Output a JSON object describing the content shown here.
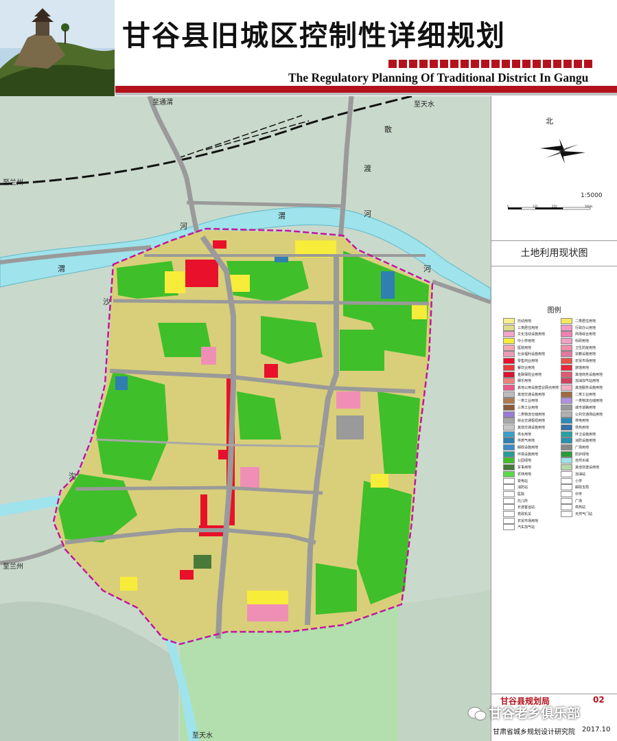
{
  "header": {
    "title_cn": "甘谷县旧城区控制性详细规划",
    "title_en": "The Regulatory Planning Of Traditional District In Gangu"
  },
  "map": {
    "direction_labels": {
      "to_tongwei": "至通渭",
      "to_tianshui_top": "至天水",
      "to_lanzhou_top": "至兰州",
      "to_lanzhou_bottom": "至兰州",
      "to_tianshui_bottom": "至天水"
    },
    "river_labels": {
      "wei_1": "渭",
      "he_1": "河",
      "wei_2": "渭",
      "he_2": "河",
      "san": "散",
      "du": "渡",
      "he_3": "河",
      "sha": "沙",
      "gou": "沟"
    },
    "colors": {
      "residential": "#d9cf7a",
      "green": "#3fbf2a",
      "commercial": "#e8102a",
      "school": "#f7ec3a",
      "pink": "#f08fb5",
      "road": "#9a9a9a",
      "river": "#9fe3ec",
      "terrain": "#c9d9cc",
      "boundary": "#c0169a"
    }
  },
  "panel": {
    "north_label": "北",
    "scale_ratio": "1:5000",
    "scale_ticks": [
      "0",
      "125",
      "250",
      "500m"
    ],
    "sheet_title": "土地利用现状图",
    "legend_title": "图例",
    "legend_left": [
      {
        "label": "托幼用地",
        "color": "#f7f08a"
      },
      {
        "label": "三类居住用地",
        "color": "#e2d98a"
      },
      {
        "label": "文化活动设施用地",
        "color": "#f2a6c6"
      },
      {
        "label": "中小学用地",
        "color": "#f7ec3a"
      },
      {
        "label": "医院用地",
        "color": "#f4a7b0"
      },
      {
        "label": "社会福利设施用地",
        "color": "#e99bb6"
      },
      {
        "label": "零售商业用地",
        "color": "#e8102a"
      },
      {
        "label": "餐饮业用地",
        "color": "#e83a3a"
      },
      {
        "label": "金融保险业用地",
        "color": "#d41430"
      },
      {
        "label": "娱乐用地",
        "color": "#f57f7f"
      },
      {
        "label": "其他公用设施营业网点用地",
        "color": "#e85a8a"
      },
      {
        "label": "其他交通设施用地",
        "color": "#bcbcbc"
      },
      {
        "label": "一类工业用地",
        "color": "#b07a50"
      },
      {
        "label": "三类工业用地",
        "color": "#8a5a3a"
      },
      {
        "label": "二类物流仓储用地",
        "color": "#9a7ad6"
      },
      {
        "label": "综合交通枢纽用地",
        "color": "#a8a8a8"
      },
      {
        "label": "其他交通设施用地",
        "color": "#c8c8c8"
      },
      {
        "label": "供水用地",
        "color": "#3aa0c8"
      },
      {
        "label": "供燃气用地",
        "color": "#2f7fb0"
      },
      {
        "label": "邮政设施用地",
        "color": "#3a8ac8"
      },
      {
        "label": "环境设施用地",
        "color": "#2a9a9a"
      },
      {
        "label": "公园绿地",
        "color": "#3fbf2a"
      },
      {
        "label": "军事用地",
        "color": "#4a7a3a"
      },
      {
        "label": "农林用地",
        "color": "#5ad84a"
      },
      {
        "label": "变电站",
        "color": "#ffffff"
      },
      {
        "label": "消防站",
        "color": "#ffffff"
      },
      {
        "label": "医院",
        "color": "#ffffff"
      },
      {
        "label": "托儿所",
        "color": "#ffffff"
      },
      {
        "label": "长途客运站",
        "color": "#ffffff"
      },
      {
        "label": "党政机关",
        "color": "#ffffff"
      },
      {
        "label": "农贸市场用地",
        "color": "#ffffff"
      },
      {
        "label": "汽车加气站",
        "color": "#ffffff"
      }
    ],
    "legend_right": [
      {
        "label": "二类居住用地",
        "color": "#f2e860"
      },
      {
        "label": "行政办公用地",
        "color": "#f49ac8"
      },
      {
        "label": "商场综合用地",
        "color": "#f280b0"
      },
      {
        "label": "科研用地",
        "color": "#f0a0c0"
      },
      {
        "label": "卫生防疫用地",
        "color": "#ee90aa"
      },
      {
        "label": "宗教设施用地",
        "color": "#e27aa0"
      },
      {
        "label": "农贸市场用地",
        "color": "#e8504a"
      },
      {
        "label": "旅馆用地",
        "color": "#e8283a"
      },
      {
        "label": "其他商务设施用地",
        "color": "#e05a70"
      },
      {
        "label": "加油加气站用地",
        "color": "#d04060"
      },
      {
        "label": "其他服务设施用地",
        "color": "#f0b0c0"
      },
      {
        "label": "二类工业用地",
        "color": "#a06a40"
      },
      {
        "label": "一类物流仓储用地",
        "color": "#b090e0"
      },
      {
        "label": "城市道路用地",
        "color": "#9a9a9a"
      },
      {
        "label": "公共交通场站用地",
        "color": "#b0b0b0"
      },
      {
        "label": "供电用地",
        "color": "#2a8ab8"
      },
      {
        "label": "供热用地",
        "color": "#3a70a8"
      },
      {
        "label": "环卫设施用地",
        "color": "#2aa0a0"
      },
      {
        "label": "消防设施用地",
        "color": "#2a90b0"
      },
      {
        "label": "广场用地",
        "color": "#8a8a8a"
      },
      {
        "label": "防护绿地",
        "color": "#2a9a3a"
      },
      {
        "label": "自然水域",
        "color": "#9fe3ec"
      },
      {
        "label": "其他非建设用地",
        "color": "#b8d8a8"
      },
      {
        "label": "加油站",
        "color": "#ffffff"
      },
      {
        "label": "小学",
        "color": "#ffffff"
      },
      {
        "label": "邮政支局",
        "color": "#ffffff"
      },
      {
        "label": "中学",
        "color": "#ffffff"
      },
      {
        "label": "广场",
        "color": "#ffffff"
      },
      {
        "label": "供热站",
        "color": "#ffffff"
      },
      {
        "label": "天然气门站",
        "color": "#ffffff"
      }
    ]
  },
  "footer": {
    "agency": "甘谷县规划局",
    "sheet_no": "02",
    "institute": "甘肃省城乡规划设计研究院",
    "date": "2017.10",
    "watermark": "甘谷老乡俱乐部"
  }
}
